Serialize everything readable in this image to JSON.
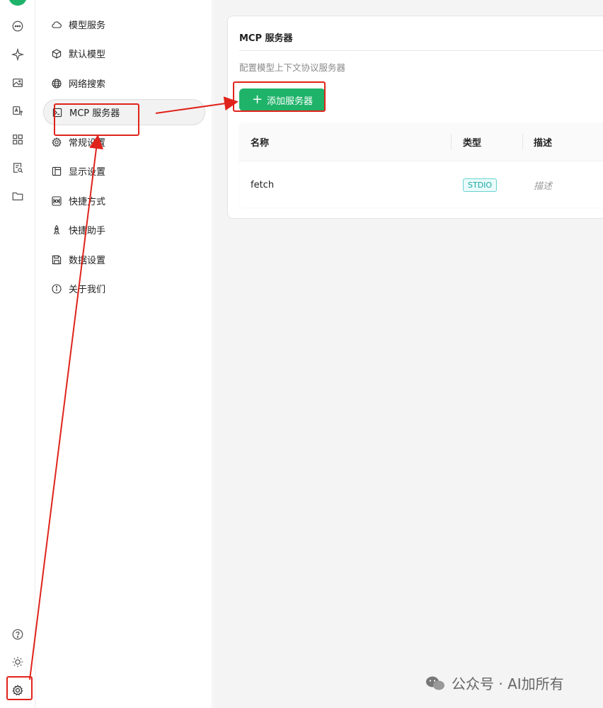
{
  "rail": {
    "top_icons": [
      "chat-icon",
      "sparkle-icon",
      "image-icon",
      "translate-icon",
      "apps-icon",
      "document-search-icon",
      "folder-icon"
    ],
    "bottom_icons": [
      "help-icon",
      "theme-icon",
      "settings-icon"
    ]
  },
  "menu": {
    "items": [
      {
        "label": "模型服务",
        "icon": "cloud-icon"
      },
      {
        "label": "默认模型",
        "icon": "cube-icon"
      },
      {
        "label": "网络搜索",
        "icon": "globe-icon"
      },
      {
        "label": "MCP 服务器",
        "icon": "terminal-icon"
      },
      {
        "label": "常规设置",
        "icon": "gear-icon"
      },
      {
        "label": "显示设置",
        "icon": "layout-icon"
      },
      {
        "label": "快捷方式",
        "icon": "command-icon"
      },
      {
        "label": "快捷助手",
        "icon": "rocket-icon"
      },
      {
        "label": "数据设置",
        "icon": "save-icon"
      },
      {
        "label": "关于我们",
        "icon": "info-icon"
      }
    ],
    "active_index": 3
  },
  "mcp": {
    "title": "MCP 服务器",
    "description": "配置模型上下文协议服务器",
    "add_button": "添加服务器",
    "table": {
      "headers": [
        "名称",
        "类型",
        "描述"
      ],
      "rows": [
        {
          "name": "fetch",
          "type": "STDIO",
          "description": "描述"
        }
      ]
    }
  },
  "watermark": "公众号 · AI加所有",
  "colors": {
    "accent_green": "#1fb36a",
    "annotation_red": "#e0231b",
    "badge_teal": "#19a9a3"
  }
}
